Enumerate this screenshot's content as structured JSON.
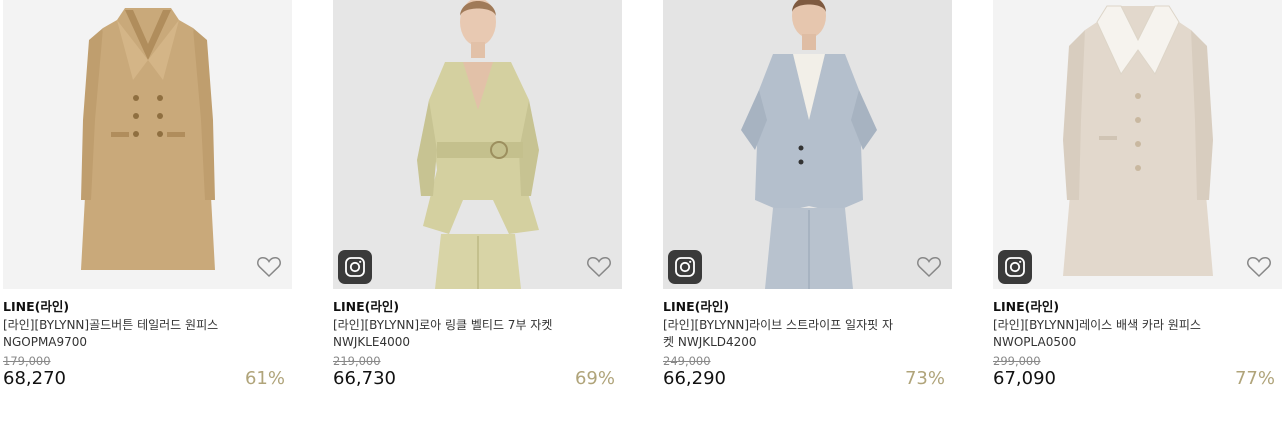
{
  "products": [
    {
      "brand": "LINE(라인)",
      "name": "[라인][BYLYNN]골드버튼 테일러드 원피스",
      "code": "NGOPMA9700",
      "original_price": "179,000",
      "sale_price": "68,270",
      "discount": "61%",
      "has_instagram": false,
      "bg_color": "#f3f3f3",
      "garment_color": "#c9a97a"
    },
    {
      "brand": "LINE(라인)",
      "name": "[라인][BYLYNN]로아 링클 벨티드 7부 자켓",
      "code": "NWJKLE4000",
      "original_price": "219,000",
      "sale_price": "66,730",
      "discount": "69%",
      "has_instagram": true,
      "bg_color": "#e6e6e6",
      "garment_color": "#d4d0a0"
    },
    {
      "brand": "LINE(라인)",
      "name": "[라인][BYLYNN]라이브 스트라이프 일자핏 자",
      "name_line2": "켓 NWJKLD4200",
      "original_price": "249,000",
      "sale_price": "66,290",
      "discount": "73%",
      "has_instagram": true,
      "bg_color": "#e4e4e4",
      "garment_color": "#b4bfcc"
    },
    {
      "brand": "LINE(라인)",
      "name": "[라인][BYLYNN]레이스 배색 카라 원피스",
      "code": "NWOPLA0500",
      "original_price": "299,000",
      "sale_price": "67,090",
      "discount": "77%",
      "has_instagram": true,
      "bg_color": "#f3f3f3",
      "garment_color": "#e2d8cc"
    }
  ],
  "icons": {
    "wishlist": "heart-outline-icon",
    "instagram": "instagram-icon"
  },
  "colors": {
    "discount": "#b0a47a",
    "text": "#111111",
    "muted": "#888888"
  }
}
